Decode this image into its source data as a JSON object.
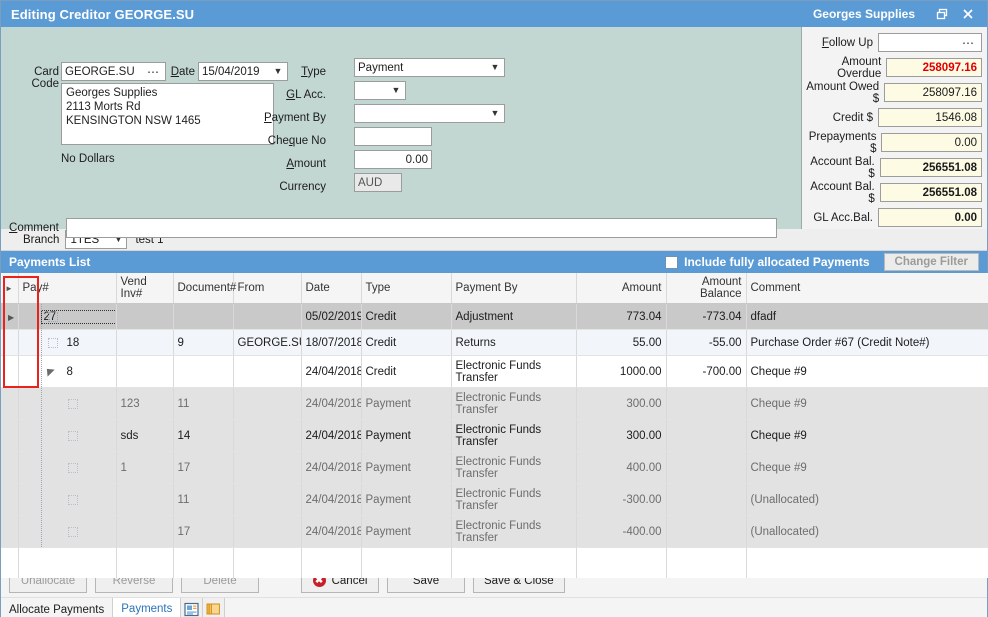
{
  "window": {
    "title": "Editing Creditor GEORGE.SU",
    "card_name": "Georges Supplies",
    "restore_label": "Restore",
    "close_label": "Close"
  },
  "form": {
    "card_code_label": "Card Code",
    "card_code_value": "GEORGE.SU",
    "card_code_ellipsis": "⋯",
    "date_label": "Date",
    "date_value": "15/04/2019",
    "address": "Georges Supplies\n2113 Morts Rd\nKENSINGTON NSW  1465",
    "no_dollars": "No Dollars",
    "type_label": "Type",
    "type_value": "Payment",
    "gl_acc_label": "GL Acc.",
    "gl_acc_value": "",
    "payment_by_label": "Payment By",
    "payment_by_value": "",
    "cheque_no_label": "Cheque No",
    "cheque_no_value": "",
    "amount_label": "Amount",
    "amount_value": "0.00",
    "currency_label": "Currency",
    "currency_value": "AUD",
    "comment_label": "Comment",
    "comment_value": ""
  },
  "totals": [
    {
      "label": "Follow Up",
      "value": "",
      "style": "white"
    },
    {
      "label": "Amount Overdue",
      "value": "258097.16",
      "style": "red"
    },
    {
      "label": "Amount Owed $",
      "value": "258097.16",
      "style": ""
    },
    {
      "label": "Credit $",
      "value": "1546.08",
      "style": ""
    },
    {
      "label": "Prepayments $",
      "value": "0.00",
      "style": ""
    },
    {
      "label": "Account Bal. $",
      "value": "256551.08",
      "style": "bold"
    },
    {
      "label": "Account Bal. $",
      "value": "256551.08",
      "style": "bold"
    },
    {
      "label": "GL Acc.Bal.",
      "value": "0.00",
      "style": "bold"
    }
  ],
  "branch": {
    "label": "Branch",
    "value": "1TES",
    "description": "test 1"
  },
  "payments_list": {
    "title": "Payments List",
    "include_allocated_label": "Include fully allocated Payments",
    "include_allocated_checked": false,
    "change_filter_label": "Change Filter",
    "columns": [
      "Pay#",
      "Vend Inv#",
      "Document#",
      "From",
      "Date",
      "Type",
      "Payment By",
      "Amount",
      "Amount Balance",
      "Comment"
    ],
    "rows": [
      {
        "level": 0,
        "expander": "collapsed",
        "selected": true,
        "pay": "27",
        "vend": "",
        "doc": "",
        "from": "",
        "date": "05/02/2019",
        "type": "Credit",
        "payment_by": "Adjustment",
        "amount": "773.04",
        "balance": "-773.04",
        "comment": "dfadf"
      },
      {
        "level": 0,
        "expander": "none",
        "alt": true,
        "pay": "18",
        "vend": "",
        "doc": "9",
        "from": "GEORGE.SU",
        "date": "18/07/2018",
        "type": "Credit",
        "payment_by": "Returns",
        "amount": "55.00",
        "balance": "-55.00",
        "comment": "Purchase Order #67 (Credit Note#)"
      },
      {
        "level": 0,
        "expander": "expanded",
        "pay": "8",
        "vend": "",
        "doc": "",
        "from": "",
        "date": "24/04/2018",
        "type": "Credit",
        "payment_by": "Electronic Funds Transfer",
        "amount": "1000.00",
        "balance": "-700.00",
        "comment": "Cheque #9"
      },
      {
        "level": 1,
        "pay": "",
        "vend": "123",
        "doc": "11",
        "from": "",
        "date": "24/04/2018",
        "type": "Payment",
        "payment_by": "Electronic Funds Transfer",
        "amount": "300.00",
        "balance": "",
        "comment": "Cheque #9"
      },
      {
        "level": 1,
        "highlight": true,
        "pay": "",
        "vend": "sds",
        "doc": "14",
        "from": "",
        "date": "24/04/2018",
        "type": "Payment",
        "payment_by": "Electronic Funds Transfer",
        "amount": "300.00",
        "balance": "",
        "comment": "Cheque #9"
      },
      {
        "level": 1,
        "pay": "",
        "vend": "1",
        "doc": "17",
        "from": "",
        "date": "24/04/2018",
        "type": "Payment",
        "payment_by": "Electronic Funds Transfer",
        "amount": "400.00",
        "balance": "",
        "comment": "Cheque #9"
      },
      {
        "level": 1,
        "pay": "",
        "vend": "",
        "doc": "11",
        "from": "",
        "date": "24/04/2018",
        "type": "Payment",
        "payment_by": "Electronic Funds Transfer",
        "amount": "-300.00",
        "balance": "",
        "comment": "(Unallocated)"
      },
      {
        "level": 1,
        "pay": "",
        "vend": "",
        "doc": "17",
        "from": "",
        "date": "24/04/2018",
        "type": "Payment",
        "payment_by": "Electronic Funds Transfer",
        "amount": "-400.00",
        "balance": "",
        "comment": "(Unallocated)"
      }
    ]
  },
  "buttons": {
    "unallocate": "Unallocate",
    "reverse": "Reverse",
    "delete": "Delete",
    "cancel": "Cancel",
    "save": "Save",
    "save_close": "Save & Close"
  },
  "tabs": [
    {
      "label": "Allocate Payments",
      "active": false
    },
    {
      "label": "Payments",
      "active": true
    }
  ],
  "colors": {
    "accent": "#5b9bd5",
    "form_bg": "#c3d7d2",
    "field_yellow": "#fdfbe4",
    "alert_red": "#e00000",
    "annotation_red": "#e8231b"
  }
}
